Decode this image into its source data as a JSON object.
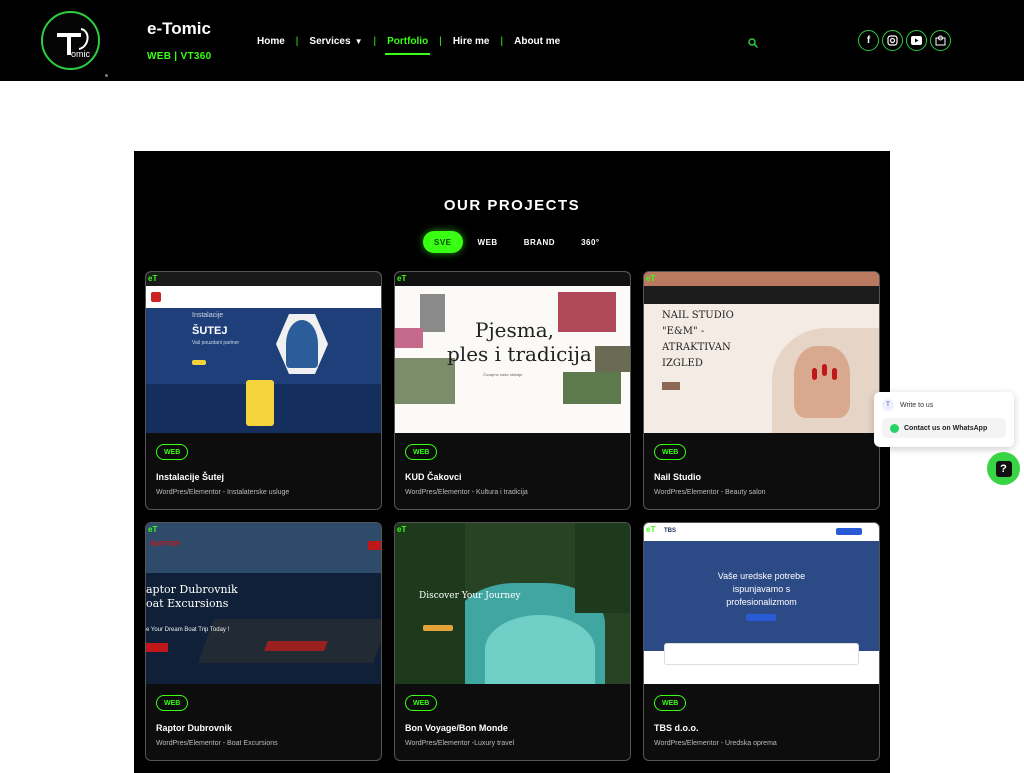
{
  "header": {
    "brand_title": "e-Tomic",
    "brand_sub": "WEB | VT360",
    "logo_text": "omic"
  },
  "nav": {
    "home": "Home",
    "services": "Services",
    "portfolio": "Portfolio",
    "hire": "Hire me",
    "about": "About me",
    "sep": "|"
  },
  "projects": {
    "title": "OUR PROJECTS",
    "filters": [
      "SVE",
      "WEB",
      "BRAND",
      "360°"
    ],
    "et_badge": "eT",
    "cards": [
      {
        "tag": "WEB",
        "title": "Instalacije Šutej",
        "desc": "WordPres/Elementor - Instalaterske usluge",
        "shot_line1": "Instalacije",
        "shot_line2": "ŠUTEJ",
        "shot_line3": "Vaš pouzdani partner"
      },
      {
        "tag": "WEB",
        "title": "KUD Čakovci",
        "desc": "WordPres/Elementor - Kultura i tradicija",
        "shot_line1": "Pjesma,",
        "shot_line2": "ples i tradicija",
        "shot_line3": "Čuvajmo naše običaje"
      },
      {
        "tag": "WEB",
        "title": "Nail Studio",
        "desc": "WordPres/Elementor - Beauty salon",
        "shot_line1": "NAIL STUDIO",
        "shot_line2": "\"E&M\" -",
        "shot_line3": "ATRAKTIVAN",
        "shot_line4": "IZGLED"
      },
      {
        "tag": "WEB",
        "title": "Raptor Dubrovnik",
        "desc": "WordPres/Elementor - Boat Excursions",
        "shot_line1": "aptor Dubrovnik",
        "shot_line2": "oat Excursions",
        "shot_line3": "e Your Dream Boat Trip Today !",
        "shot_logo": "RAPTOR"
      },
      {
        "tag": "WEB",
        "title": "Bon Voyage/Bon Monde",
        "desc": "WordPres/Elementor -Luxury travel",
        "shot_line1": "Discover Your Journey"
      },
      {
        "tag": "WEB",
        "title": "TBS d.o.o.",
        "desc": "WordPres/Elementor - Uredska oprema",
        "shot_line1": "Vaše uredske potrebe",
        "shot_line2": "ispunjavamo s",
        "shot_line3": "profesionalizmom",
        "shot_logo": "TBS"
      }
    ]
  },
  "widget": {
    "write": "Write to us",
    "whatsapp": "Contact us on WhatsApp",
    "help": "?"
  },
  "colors": {
    "accent": "#39ff14",
    "header_bg": "#000000",
    "panel_bg": "#000000"
  },
  "icons": [
    "search-icon",
    "facebook-icon",
    "instagram-icon",
    "youtube-icon",
    "contact-icon",
    "whatsapp-icon",
    "help-icon"
  ]
}
